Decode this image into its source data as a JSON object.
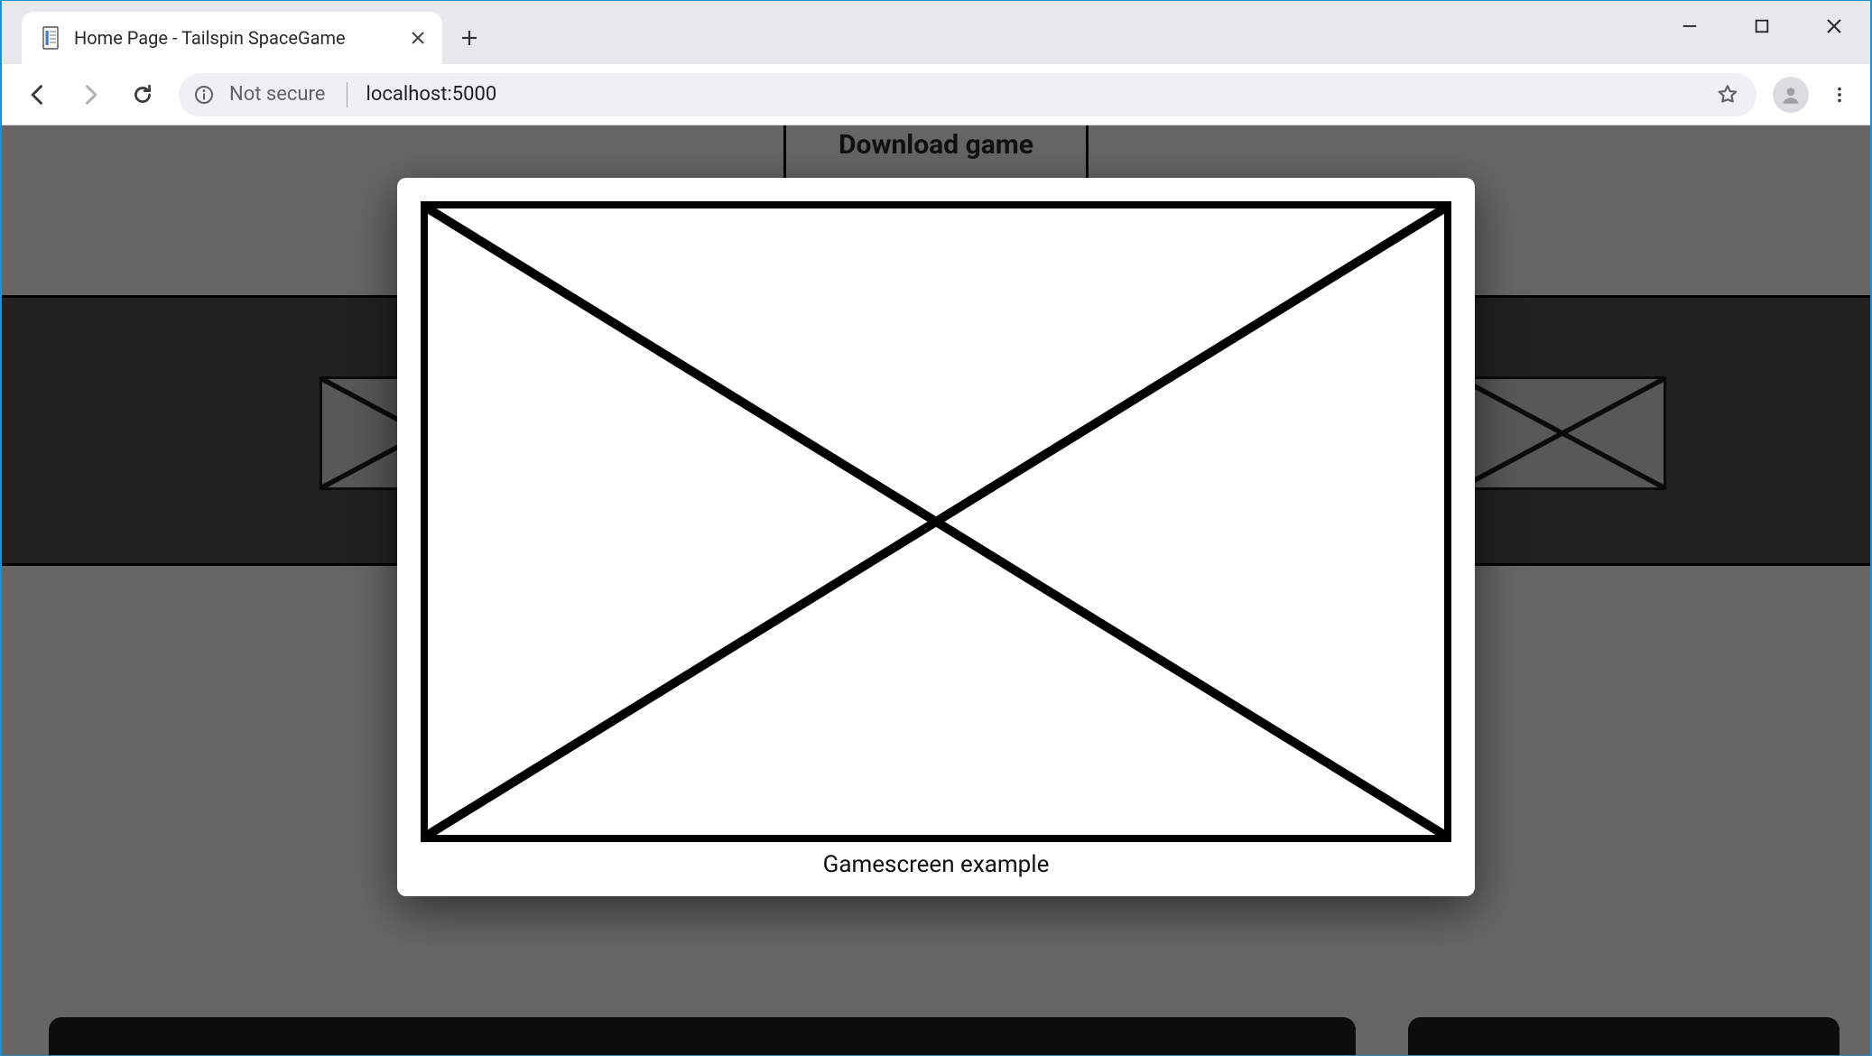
{
  "browser": {
    "tab_title": "Home Page - Tailspin SpaceGame",
    "security_label": "Not secure",
    "url": "localhost:5000"
  },
  "page": {
    "download_label": "Download game"
  },
  "modal": {
    "caption": "Gamescreen example"
  }
}
